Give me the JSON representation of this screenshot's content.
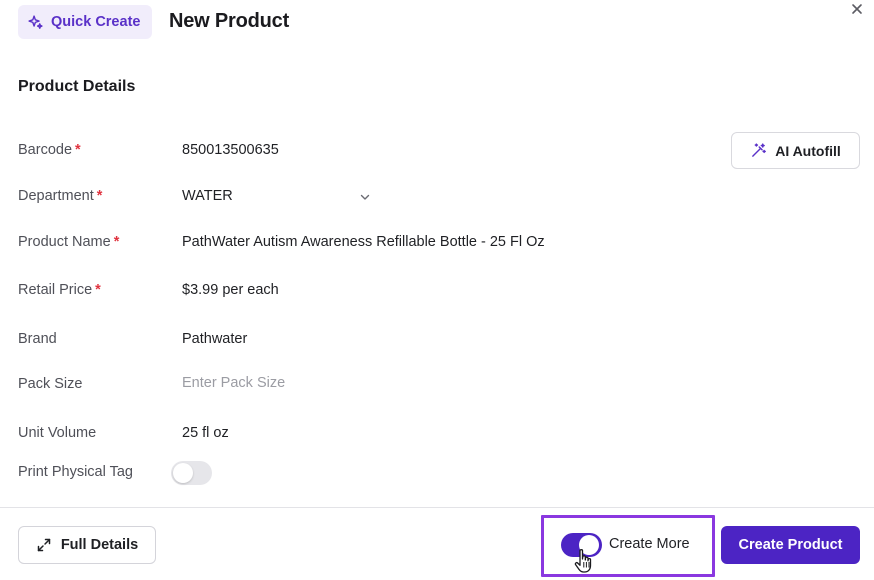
{
  "header": {
    "badge_label": "Quick Create",
    "title": "New Product"
  },
  "section_title": "Product Details",
  "fields": {
    "barcode": {
      "label": "Barcode",
      "required": "*",
      "value": "850013500635"
    },
    "department": {
      "label": "Department",
      "required": "*",
      "value": "WATER"
    },
    "product_name": {
      "label": "Product Name",
      "required": "*",
      "value": "PathWater Autism Awareness Refillable Bottle - 25 Fl Oz"
    },
    "retail_price": {
      "label": "Retail Price",
      "required": "*",
      "value": "$3.99 per each"
    },
    "brand": {
      "label": "Brand",
      "value": "Pathwater"
    },
    "pack_size": {
      "label": "Pack Size",
      "value": "",
      "placeholder": "Enter Pack Size"
    },
    "unit_volume": {
      "label": "Unit Volume",
      "value": "25 fl oz"
    },
    "print_physical_tag": {
      "label": "Print Physical Tag",
      "enabled": false
    }
  },
  "ai_autofill_label": "AI Autofill",
  "footer": {
    "full_details_label": "Full Details",
    "create_more_label": "Create More",
    "create_more_enabled": true,
    "create_product_label": "Create Product"
  },
  "colors": {
    "accent": "#4c24c4",
    "badge_bg": "#f1edfb",
    "required": "#e0333f",
    "highlight": "#8a38e0"
  },
  "icons": [
    "sparkles-icon",
    "close-icon",
    "magic-wand-icon",
    "chevron-down-icon",
    "expand-icon",
    "hand-cursor-icon"
  ]
}
